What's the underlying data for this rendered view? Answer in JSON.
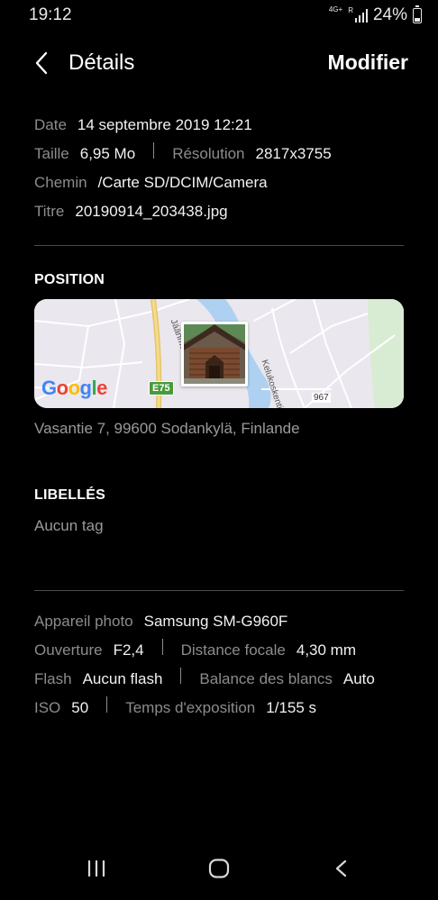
{
  "status": {
    "time": "19:12",
    "network": "4G+",
    "signal_r": "R",
    "battery": "24%"
  },
  "header": {
    "title": "Détails",
    "edit_label": "Modifier"
  },
  "file_info": {
    "date_label": "Date",
    "date_value": "14 septembre 2019 12:21",
    "size_label": "Taille",
    "size_value": "6,95 Mo",
    "resolution_label": "Résolution",
    "resolution_value": "2817x3755",
    "path_label": "Chemin",
    "path_value": "/Carte SD/DCIM/Camera",
    "title_label": "Titre",
    "title_value": "20190914_203438.jpg"
  },
  "position": {
    "heading": "POSITION",
    "address": "Vasantie 7, 99600 Sodankylä, Finlande",
    "map": {
      "logo_letters": [
        "G",
        "o",
        "o",
        "g",
        "l",
        "e"
      ],
      "route_shield": "E75",
      "road_name_1": "Jäänme",
      "road_name_2": "Kelukoskentie",
      "road_number": "967"
    }
  },
  "tags": {
    "heading": "LIBELLÉS",
    "empty_text": "Aucun tag"
  },
  "camera": {
    "camera_label": "Appareil photo",
    "camera_value": "Samsung SM-G960F",
    "aperture_label": "Ouverture",
    "aperture_value": "F2,4",
    "focal_label": "Distance focale",
    "focal_value": "4,30 mm",
    "flash_label": "Flash",
    "flash_value": "Aucun flash",
    "wb_label": "Balance des blancs",
    "wb_value": "Auto",
    "iso_label": "ISO",
    "iso_value": "50",
    "exposure_label": "Temps d'exposition",
    "exposure_value": "1/155 s"
  },
  "nav": {
    "recents_icon": "recents-icon",
    "home_icon": "home-icon",
    "back_icon": "back-icon"
  }
}
